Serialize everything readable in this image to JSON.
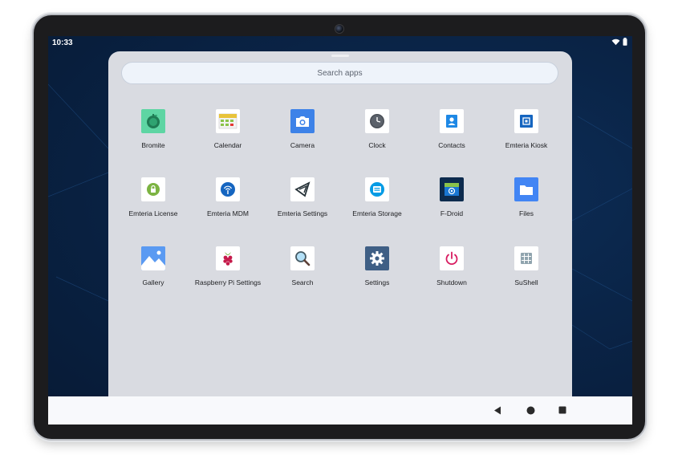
{
  "status": {
    "time": "10:33"
  },
  "search": {
    "placeholder": "Search apps"
  },
  "apps": [
    {
      "label": "Bromite",
      "icon": "bromite-icon"
    },
    {
      "label": "Calendar",
      "icon": "calendar-icon"
    },
    {
      "label": "Camera",
      "icon": "camera-icon"
    },
    {
      "label": "Clock",
      "icon": "clock-icon"
    },
    {
      "label": "Contacts",
      "icon": "contacts-icon"
    },
    {
      "label": "Emteria Kiosk",
      "icon": "kiosk-icon"
    },
    {
      "label": "Emteria License",
      "icon": "license-icon"
    },
    {
      "label": "Emteria MDM",
      "icon": "mdm-icon"
    },
    {
      "label": "Emteria Settings",
      "icon": "emteria-settings-icon"
    },
    {
      "label": "Emteria Storage",
      "icon": "storage-icon"
    },
    {
      "label": "F-Droid",
      "icon": "fdroid-icon"
    },
    {
      "label": "Files",
      "icon": "folder-icon"
    },
    {
      "label": "Gallery",
      "icon": "gallery-icon"
    },
    {
      "label": "Raspberry Pi Settings",
      "icon": "raspberry-icon"
    },
    {
      "label": "Search",
      "icon": "magnifier-icon"
    },
    {
      "label": "Settings",
      "icon": "gear-icon"
    },
    {
      "label": "Shutdown",
      "icon": "power-icon"
    },
    {
      "label": "SuShell",
      "icon": "shell-icon"
    }
  ],
  "colors": {
    "wallpaper": "#0a2447",
    "drawer": "#d9dbe1",
    "nav_bar": "#f8f9fc",
    "accent_blue": "#4285f4"
  }
}
